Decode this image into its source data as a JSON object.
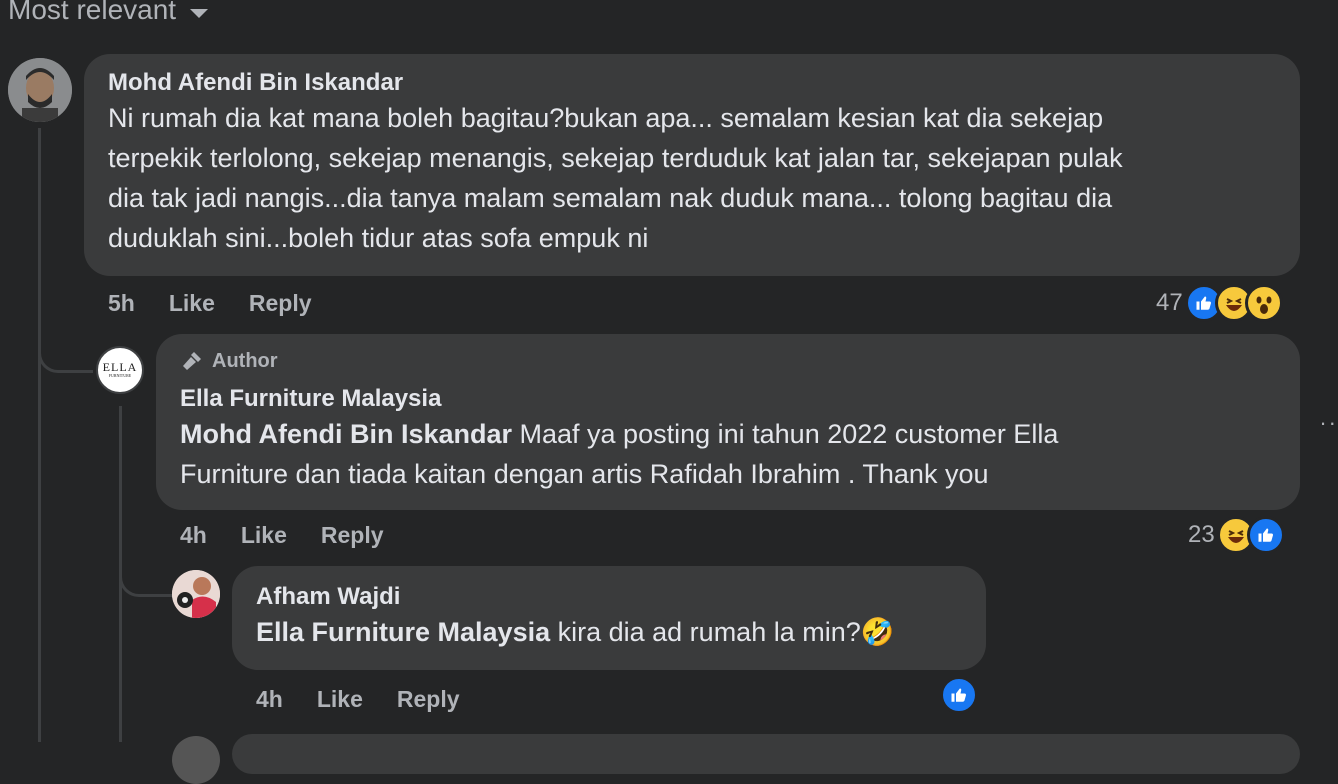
{
  "sort": {
    "label": "Most relevant"
  },
  "comments": [
    {
      "author": "Mohd Afendi Bin Iskandar",
      "lines": [
        "Ni rumah dia kat mana boleh bagitau?bukan apa... semalam kesian kat dia sekejap",
        "terpekik terlolong, sekejap menangis, sekejap terduduk kat jalan tar, sekejapan pulak",
        "dia tak jadi nangis...dia tanya malam semalam nak duduk mana... tolong bagitau dia",
        "duduklah sini...boleh tidur atas sofa empuk ni"
      ],
      "time": "5h",
      "like_label": "Like",
      "reply_label": "Reply",
      "reaction_count": "47",
      "reactions": [
        "like-icon",
        "haha-icon",
        "wow-icon"
      ]
    },
    {
      "badge": "Author",
      "author": "Ella Furniture Malaysia",
      "mention": "Mohd Afendi Bin Iskandar",
      "line1_rest": " Maaf ya posting ini tahun 2022 customer Ella",
      "line2": "Furniture dan tiada kaitan dengan artis Rafidah Ibrahim . Thank you",
      "avatar_text": "ELLA",
      "avatar_sub": "FURNITURE",
      "time": "4h",
      "like_label": "Like",
      "reply_label": "Reply",
      "reaction_count": "23",
      "reactions": [
        "haha-icon",
        "like-icon"
      ]
    },
    {
      "author": "Afham Wajdi",
      "mention": "Ella Furniture Malaysia",
      "text_rest": " kira dia ad rumah la min?",
      "emoji": "🤣",
      "time": "4h",
      "like_label": "Like",
      "reply_label": "Reply",
      "reactions": [
        "like-icon"
      ]
    }
  ],
  "more_label": "··"
}
